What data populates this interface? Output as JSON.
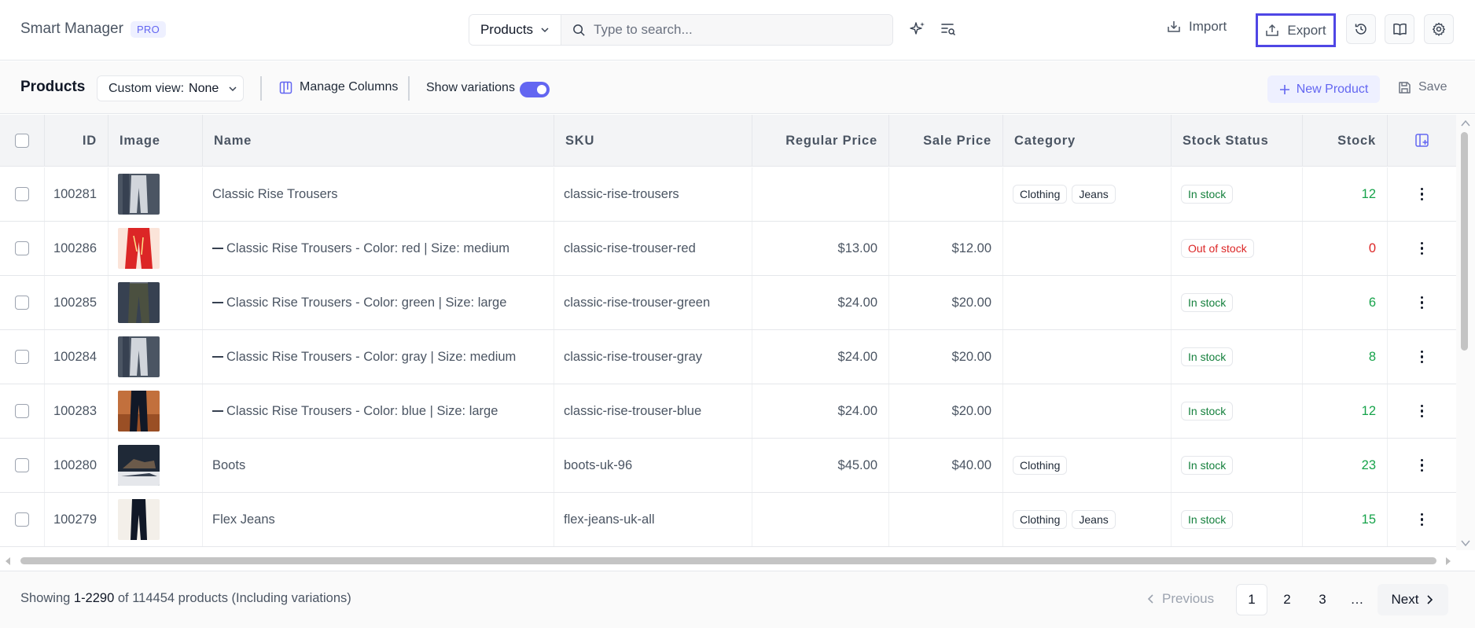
{
  "app": {
    "name": "Smart Manager",
    "badge": "PRO"
  },
  "search": {
    "entity": "Products",
    "placeholder": "Type to search..."
  },
  "header_actions": {
    "import_label": "Import",
    "export_label": "Export"
  },
  "toolbar": {
    "title": "Products",
    "custom_view_label": "Custom view:",
    "custom_view_value": "None",
    "manage_columns": "Manage Columns",
    "show_variations": "Show variations",
    "show_variations_on": true,
    "new_product": "New Product",
    "save": "Save"
  },
  "table": {
    "columns": [
      "ID",
      "Image",
      "Name",
      "SKU",
      "Regular Price",
      "Sale Price",
      "Category",
      "Stock Status",
      "Stock"
    ],
    "rows": [
      {
        "id": "100281",
        "image": "gray-trousers",
        "name": "Classic Rise Trousers",
        "variation": false,
        "sku": "classic-rise-trousers",
        "regular_price": "",
        "sale_price": "",
        "categories": [
          "Clothing",
          "Jeans"
        ],
        "stock_status": "In stock",
        "stock": "12"
      },
      {
        "id": "100286",
        "image": "red-trousers",
        "name": "Classic Rise Trousers - Color: red | Size: medium",
        "variation": true,
        "sku": "classic-rise-trouser-red",
        "regular_price": "$13.00",
        "sale_price": "$12.00",
        "categories": [],
        "stock_status": "Out of stock",
        "stock": "0"
      },
      {
        "id": "100285",
        "image": "green-trousers",
        "name": "Classic Rise Trousers - Color: green | Size: large",
        "variation": true,
        "sku": "classic-rise-trouser-green",
        "regular_price": "$24.00",
        "sale_price": "$20.00",
        "categories": [],
        "stock_status": "In stock",
        "stock": "6"
      },
      {
        "id": "100284",
        "image": "gray-trousers",
        "name": "Classic Rise Trousers - Color: gray | Size: medium",
        "variation": true,
        "sku": "classic-rise-trouser-gray",
        "regular_price": "$24.00",
        "sale_price": "$20.00",
        "categories": [],
        "stock_status": "In stock",
        "stock": "8"
      },
      {
        "id": "100283",
        "image": "blue-trousers",
        "name": "Classic Rise Trousers - Color: blue | Size: large",
        "variation": true,
        "sku": "classic-rise-trouser-blue",
        "regular_price": "$24.00",
        "sale_price": "$20.00",
        "categories": [],
        "stock_status": "In stock",
        "stock": "12"
      },
      {
        "id": "100280",
        "image": "boots",
        "name": "Boots",
        "variation": false,
        "sku": "boots-uk-96",
        "regular_price": "$45.00",
        "sale_price": "$40.00",
        "categories": [
          "Clothing"
        ],
        "stock_status": "In stock",
        "stock": "23"
      },
      {
        "id": "100279",
        "image": "flex-jeans",
        "name": "Flex Jeans",
        "variation": false,
        "sku": "flex-jeans-uk-all",
        "regular_price": "",
        "sale_price": "",
        "categories": [
          "Clothing",
          "Jeans"
        ],
        "stock_status": "In stock",
        "stock": "15"
      }
    ]
  },
  "footer": {
    "showing_prefix": "Showing",
    "range": "1-2290",
    "of_text": "of",
    "total": "114454",
    "suffix": "products (Including variations)",
    "previous": "Previous",
    "pages": [
      "1",
      "2",
      "3"
    ],
    "ellipsis": "…",
    "current_page": "1",
    "next": "Next"
  },
  "colors": {
    "accent": "#6366f1",
    "export_highlight": "#4f46e5",
    "in_stock": "#15803d",
    "out_of_stock": "#dc2626"
  }
}
